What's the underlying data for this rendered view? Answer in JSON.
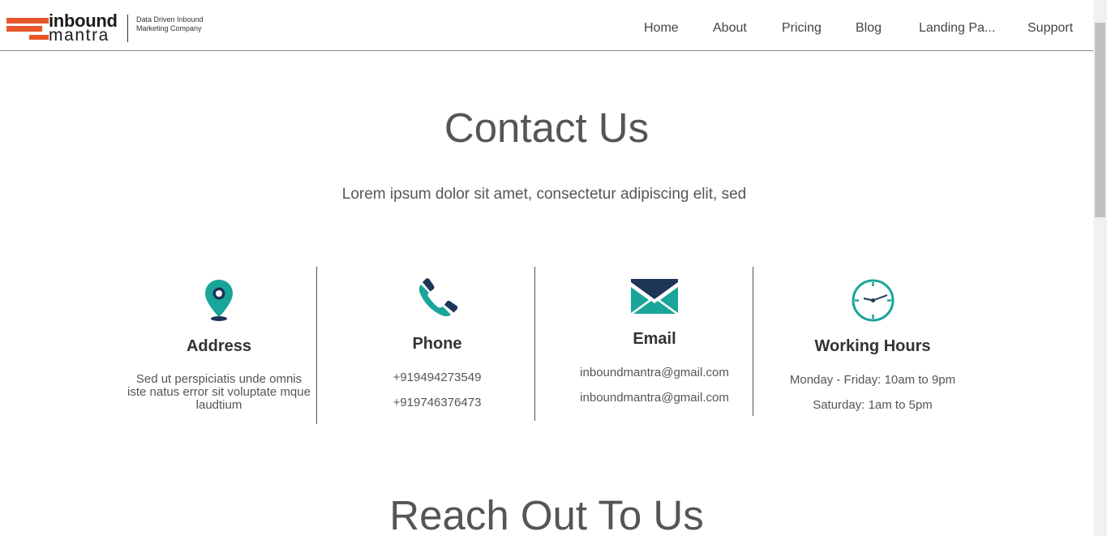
{
  "brand": {
    "word1": "inbound",
    "word2": "mantra",
    "tagline": "Data Driven Inbound Marketing Company"
  },
  "nav": {
    "items": [
      {
        "label": "Home"
      },
      {
        "label": "About"
      },
      {
        "label": "Pricing"
      },
      {
        "label": "Blog"
      },
      {
        "label": "Landing Pa..."
      },
      {
        "label": "Support"
      }
    ]
  },
  "hero": {
    "title": "Contact Us",
    "subtitle": "Lorem ipsum dolor sit amet, consectetur adipiscing elit, sed"
  },
  "contact": {
    "address": {
      "heading": "Address",
      "icon": "location-pin-icon",
      "text": "Sed ut perspiciatis unde omnis iste natus error sit voluptate mque laudtium"
    },
    "phone": {
      "heading": "Phone",
      "icon": "phone-icon",
      "lines": [
        "+919494273549",
        "+919746376473"
      ]
    },
    "email": {
      "heading": "Email",
      "icon": "envelope-icon",
      "lines": [
        "inboundmantra@gmail.com",
        "inboundmantra@gmail.com"
      ]
    },
    "hours": {
      "heading": "Working Hours",
      "icon": "clock-icon",
      "lines": [
        "Monday - Friday: 10am to 9pm",
        "Saturday: 1am to 5pm"
      ]
    }
  },
  "reach": {
    "title": "Reach Out To Us"
  },
  "colors": {
    "brand_orange": "#e8562a",
    "teal": "#1aa59a",
    "navy": "#1d3557"
  }
}
